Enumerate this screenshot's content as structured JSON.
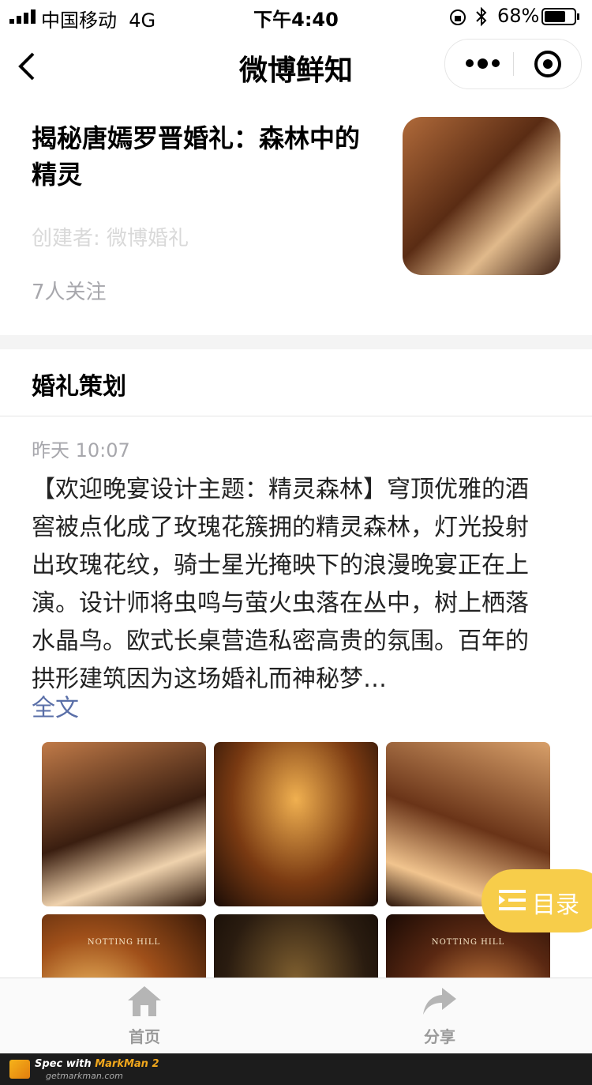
{
  "status_bar": {
    "carrier": "中国移动",
    "network": "4G",
    "time": "下午4:40",
    "battery": "68%"
  },
  "nav": {
    "title": "微博鲜知"
  },
  "topic": {
    "title": "揭秘唐嫣罗晋婚礼：森林中的精灵",
    "creator": "创建者: 微博婚礼",
    "followers": "7人关注"
  },
  "section": {
    "title": "婚礼策划"
  },
  "post": {
    "time": "昨天 10:07",
    "text": "【欢迎晚宴设计主题：精灵森林】穹顶优雅的酒窖被点化成了玫瑰花簇拥的精灵森林，灯光投射出玫瑰花纹，骑士星光掩映下的浪漫晚宴正在上演。设计师将虫鸣与萤火虫落在丛中，树上栖落水晶鸟。欧式长桌营造私密高贵的氛围。百年的拱形建筑因为这场婚礼而神秘梦…",
    "full_text_link": "全文",
    "images": [
      {
        "brand": ""
      },
      {
        "brand": ""
      },
      {
        "brand": ""
      },
      {
        "brand": "NOTTING HILL"
      },
      {
        "brand": ""
      },
      {
        "brand": "NOTTING HILL"
      }
    ]
  },
  "toc_button": {
    "label": "目录"
  },
  "tabbar": {
    "home": "首页",
    "share": "分享"
  },
  "footer": {
    "brand_prefix": "Spec with ",
    "brand_name": "MarkMan 2",
    "url": "getmarkman.com"
  },
  "colors": {
    "creator_text": "#d9d9d9",
    "gap": "#f4f4f4",
    "time_text": "#a7a7ac",
    "link": "#a2abc1",
    "toc": "#f7cd4a"
  }
}
